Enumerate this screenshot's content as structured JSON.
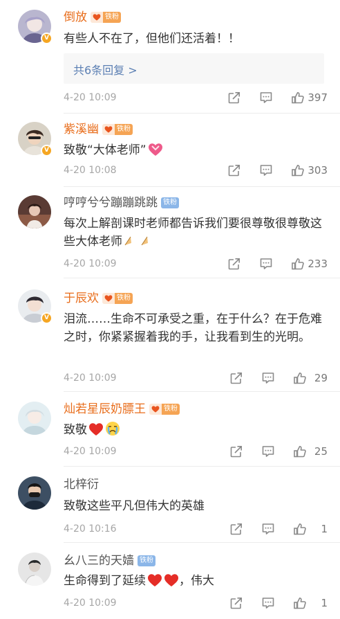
{
  "comments": [
    {
      "name": "倒放",
      "fan_badge": "铁粉",
      "verified": "V",
      "text": "有些人不在了，但他们还活着！！",
      "replies": "共6条回复 >",
      "time": "4-20 10:09",
      "likes": "397"
    },
    {
      "name": "紫溪幽",
      "fan_badge": "铁粉",
      "verified": "V",
      "text": "致敬“大体老师”",
      "emoji": "heart-ribbon",
      "time": "4-20 10:08",
      "likes": "303"
    },
    {
      "name": "哼哼兮兮蹦蹦跳跳",
      "fan_badge": "铁粉",
      "text": "每次上解剖课时老师都告诉我们要很尊敬很尊敬这些大体老师",
      "emoji": "folded-hands",
      "time": "4-20 10:09",
      "likes": "233"
    },
    {
      "name": "于辰欢",
      "fan_badge": "铁粉",
      "verified": "V",
      "text": "泪流……生命不可承受之重，在于什么？在于危难之时，你紧紧握着我的手，让我看到生的光明。",
      "time": "4-20 10:09",
      "likes": "29"
    },
    {
      "name": "灿若星辰奶膘王",
      "fan_badge": "铁粉",
      "text": "致敬",
      "emoji": "heart-crying",
      "time": "4-20 10:09",
      "likes": "25"
    },
    {
      "name": "北梓衍",
      "text": "致敬这些平凡但伟大的英雄",
      "time": "4-20 10:16",
      "likes": "1"
    },
    {
      "name": "幺八三的天嫱",
      "fan_badge": "铁粉",
      "text_before": "生命得到了延续",
      "text_after": "，伟大",
      "emoji": "two-hearts",
      "time": "4-20 10:09",
      "likes": "1"
    }
  ],
  "icons": {
    "share": "share-icon",
    "comment": "comment-icon",
    "like": "thumbs-up-icon"
  },
  "colors": {
    "name_orange": "#e86d1b",
    "link_blue": "#5b7fb3",
    "badge_orange": "#f5a454",
    "badge_blue": "#8bb6e8"
  }
}
